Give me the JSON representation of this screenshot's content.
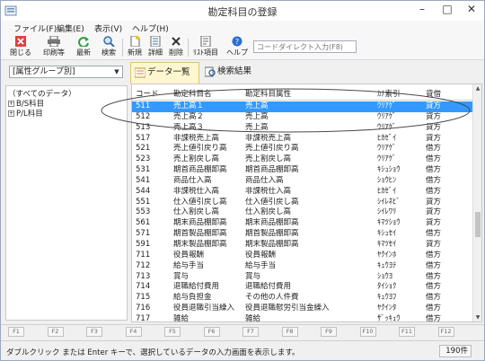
{
  "window": {
    "title": "勘定科目の登録"
  },
  "menu": [
    "ファイル(F)",
    "編集(E)",
    "表示(V)",
    "ヘルプ(H)"
  ],
  "toolbar": {
    "buttons": [
      {
        "label": "閉じる",
        "icon": "close-x-icon"
      },
      {
        "label": "印刷等",
        "icon": "printer-icon"
      },
      {
        "label": "最新",
        "icon": "refresh-icon"
      },
      {
        "label": "検索",
        "icon": "search-icon"
      },
      {
        "label": "新規",
        "icon": "new-document-icon"
      },
      {
        "label": "詳細",
        "icon": "details-icon"
      },
      {
        "label": "削除",
        "icon": "delete-icon"
      },
      {
        "label": "ﾘｽﾄ項目",
        "icon": "list-items-icon"
      },
      {
        "label": "ヘルプ",
        "icon": "help-icon"
      }
    ],
    "code_input_placeholder": "コードダイレクト入力(F8)"
  },
  "left_pane": {
    "group_select": "[属性グループ別]",
    "tree": [
      {
        "label": "（すべてのデータ）",
        "expander": ""
      },
      {
        "label": "B/S科目",
        "expander": "+"
      },
      {
        "label": "P/L科目",
        "expander": "+"
      }
    ]
  },
  "tabs": [
    {
      "label": "データ一覧",
      "active": true
    },
    {
      "label": "検索結果",
      "active": false
    }
  ],
  "grid": {
    "columns": [
      "コード",
      "勘定科目名",
      "勘定科目属性",
      "ｶﾅ索引",
      "貸借"
    ],
    "rows": [
      [
        "511",
        "売上高１",
        "売上高",
        "ｳﾘｱｹﾞ",
        "貸方"
      ],
      [
        "512",
        "売上高２",
        "売上高",
        "ｳﾘｱｹﾞ",
        "貸方"
      ],
      [
        "513",
        "売上高３",
        "売上高",
        "ｳﾘｱｹﾞ",
        "貸方"
      ],
      [
        "517",
        "非課税売上高",
        "非課税売上高",
        "ﾋｶｾﾞｲ",
        "貸方"
      ],
      [
        "521",
        "売上値引戻り高",
        "売上値引戻り高",
        "ｳﾘｱｹﾞ",
        "借方"
      ],
      [
        "523",
        "売上割戻し高",
        "売上割戻し高",
        "ｳﾘｱｹﾞ",
        "借方"
      ],
      [
        "531",
        "期首商品棚卸高",
        "期首商品棚卸高",
        "ｷｼｭｼｮｳ",
        "借方"
      ],
      [
        "541",
        "商品仕入高",
        "商品仕入高",
        "ｼｮｳﾋﾝ",
        "借方"
      ],
      [
        "544",
        "非課税仕入高",
        "非課税仕入高",
        "ﾋｶｾﾞｲ",
        "借方"
      ],
      [
        "551",
        "仕入値引戻し高",
        "仕入値引戻し高",
        "ｼｲﾚﾈﾋﾞ",
        "貸方"
      ],
      [
        "553",
        "仕入割戻し高",
        "仕入割戻し高",
        "ｼｲﾚﾜﾘ",
        "貸方"
      ],
      [
        "561",
        "期末商品棚卸高",
        "期末商品棚卸高",
        "ｷﾏﾂｼｮｳ",
        "貸方"
      ],
      [
        "571",
        "期首製品棚卸高",
        "期首製品棚卸高",
        "ｷｼｭｾｲ",
        "借方"
      ],
      [
        "591",
        "期末製品棚卸高",
        "期末製品棚卸高",
        "ｷﾏﾂｾｲ",
        "貸方"
      ],
      [
        "711",
        "役員報酬",
        "役員報酬",
        "ﾔｸｲﾝﾎ",
        "借方"
      ],
      [
        "712",
        "給与手当",
        "給与手当",
        "ｷｭｳﾖﾃ",
        "借方"
      ],
      [
        "713",
        "賞与",
        "賞与",
        "ｼｮｳﾖ",
        "借方"
      ],
      [
        "714",
        "退職給付費用",
        "退職給付費用",
        "ﾀｲｼｮｸ",
        "借方"
      ],
      [
        "715",
        "給与負担金",
        "その他の人件費",
        "ｷｭｳﾖﾌ",
        "借方"
      ],
      [
        "716",
        "役員退職引当繰入",
        "役員退職慰労引当金繰入",
        "ﾔｸｲﾝﾀ",
        "借方"
      ],
      [
        "717",
        "雑給",
        "雑給",
        "ｻﾞｯｷｭｳ",
        "借方"
      ]
    ],
    "selected_row": 0
  },
  "fkeys": [
    "F1",
    "F2",
    "F3",
    "F4",
    "F5",
    "F6",
    "F7",
    "F8",
    "F9",
    "F10",
    "F11",
    "F12"
  ],
  "status": {
    "message": "ダブルクリック または Enter キーで、選択しているデータの入力画面を表示します。",
    "count": "190件"
  },
  "colors": {
    "selection": "#3399ff",
    "active_tab": "#fdf6cf",
    "annotation": "#4a4a4a"
  }
}
